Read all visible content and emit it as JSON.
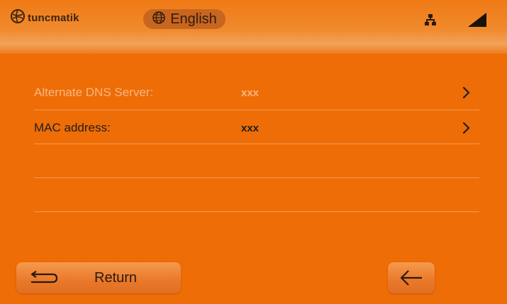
{
  "header": {
    "brand": "tuncmatik",
    "language": "English",
    "icons": {
      "logo": "globe-logo-icon",
      "language": "globe-icon",
      "network": "network-icon",
      "signal": "signal-icon"
    }
  },
  "settings_list": [
    {
      "label": "Alternate DNS Server:",
      "value": "xxx",
      "state": "disabled"
    },
    {
      "label": "MAC address:",
      "value": "xxx",
      "state": "enabled"
    }
  ],
  "footer": {
    "return_label": "Return",
    "icons": {
      "return": "return-arrow-icon",
      "back": "left-arrow-icon"
    }
  },
  "colors": {
    "background": "#ee6d06",
    "header_top": "#f07a16",
    "header_glow": "#f3a25a",
    "language_pill": "#c8651f",
    "dim_text": "#f7b683",
    "text": "#1e1e1e",
    "divider": "#f49a55"
  }
}
